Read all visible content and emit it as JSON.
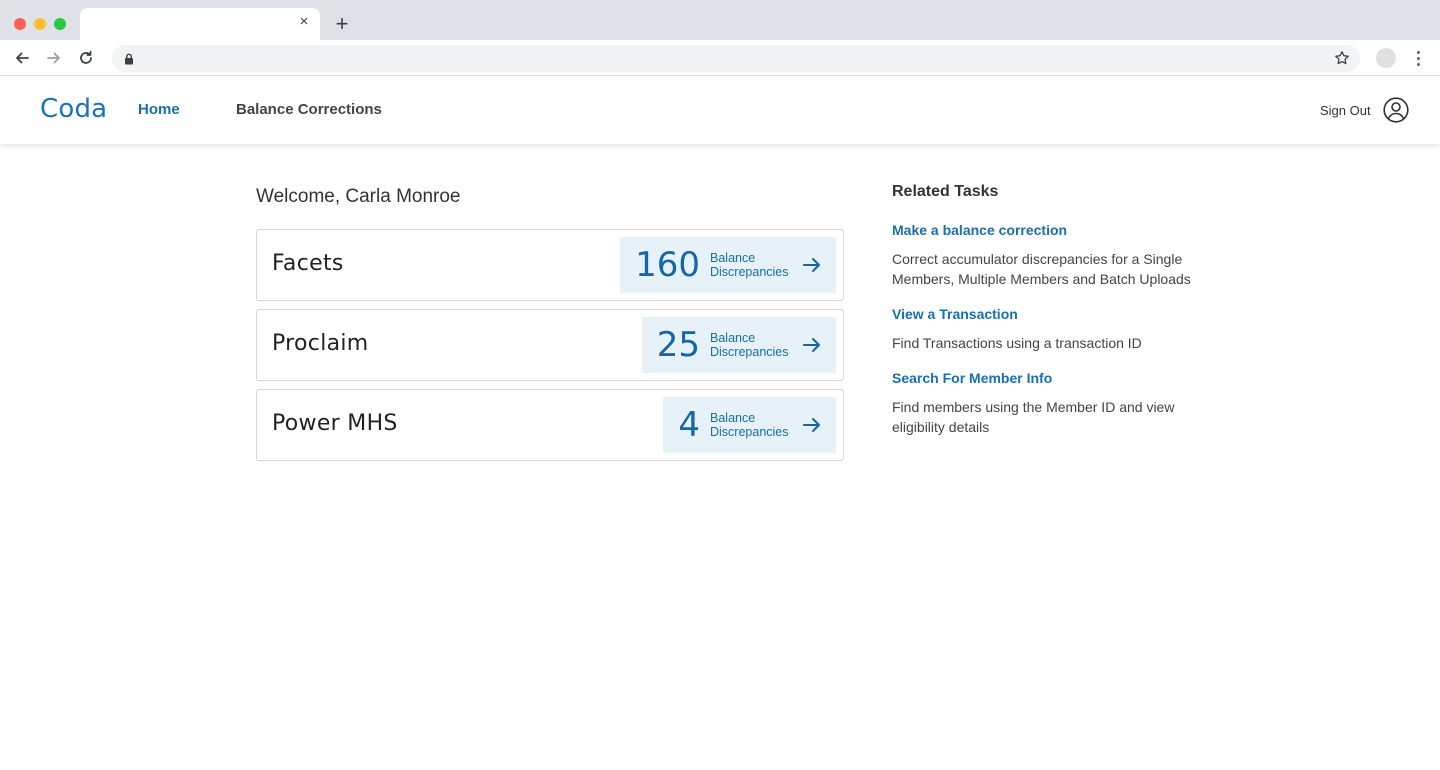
{
  "browser": {
    "tab_title": "",
    "tab_close": "×",
    "new_tab": "+",
    "url": ""
  },
  "app": {
    "logo": "Coda",
    "nav": {
      "home": "Home",
      "balance_corrections": "Balance Corrections"
    },
    "sign_out": "Sign Out"
  },
  "main": {
    "welcome": "Welcome, Carla Monroe",
    "cards": [
      {
        "name": "Facets",
        "count": "160",
        "label": "Balance Discrepancies"
      },
      {
        "name": "Proclaim",
        "count": "25",
        "label": "Balance Discrepancies"
      },
      {
        "name": "Power MHS",
        "count": "4",
        "label": "Balance Discrepancies"
      }
    ]
  },
  "related": {
    "title": "Related Tasks",
    "items": [
      {
        "link": "Make a balance correction",
        "desc": "Correct accumulator discrepancies for a Single Members, Multiple Members and Batch Uploads"
      },
      {
        "link": "View a Transaction",
        "desc": "Find Transactions using a transaction ID"
      },
      {
        "link": "Search For Member Info",
        "desc": "Find members using the Member ID and view eligibility details"
      }
    ]
  },
  "colors": {
    "brand": "#1a73b6",
    "badge_bg": "#e6f1f8",
    "link": "#1a6fae"
  },
  "icons": [
    "back-icon",
    "forward-icon",
    "reload-icon",
    "lock-icon",
    "star-icon",
    "user-icon",
    "arrow-right-icon"
  ]
}
